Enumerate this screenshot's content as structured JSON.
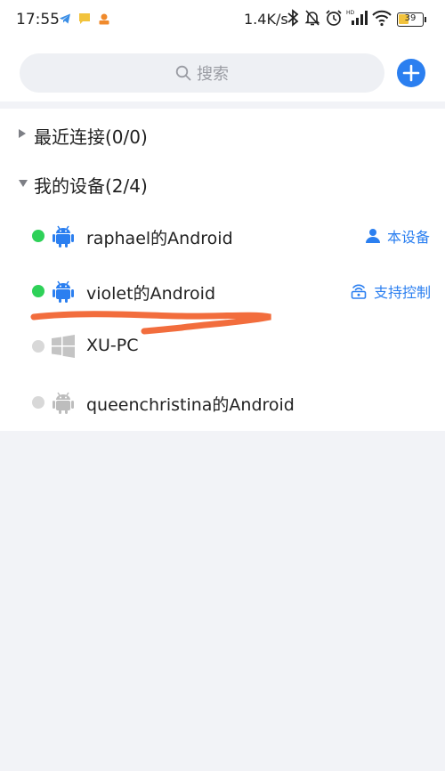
{
  "status_bar": {
    "time": "17:55",
    "speed": "1.4K/s",
    "battery": "39",
    "icons": [
      "telegram-icon",
      "message-icon",
      "app-notification-icon",
      "bluetooth-icon",
      "mute-icon",
      "alarm-icon",
      "signal-icon",
      "wifi-icon",
      "battery-icon"
    ]
  },
  "search": {
    "placeholder": "搜索"
  },
  "groups": {
    "recent": {
      "label": "最近连接(0/0)",
      "expanded": false
    },
    "mine": {
      "label": "我的设备(2/4)",
      "expanded": true
    }
  },
  "devices": [
    {
      "name": "raphael的Android",
      "status": "online",
      "platform": "android",
      "tag": "本设备"
    },
    {
      "name": "violet的Android",
      "status": "online",
      "platform": "android",
      "tag": "支持控制"
    },
    {
      "name": "XU-PC",
      "status": "offline",
      "platform": "windows"
    },
    {
      "name": "queenchristina的Android",
      "status": "offline",
      "platform": "android"
    }
  ],
  "colors": {
    "accent": "#2b7ff0",
    "online": "#2ed158",
    "offline": "#d8d8d8",
    "annotation": "#f26d3d"
  }
}
